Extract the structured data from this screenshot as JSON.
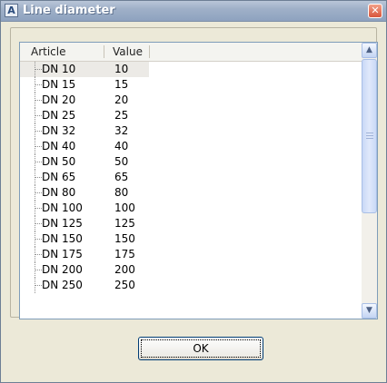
{
  "window": {
    "title": "Line diameter",
    "app_icon_glyph": "A",
    "close_glyph": "✕"
  },
  "list": {
    "columns": {
      "article": "Article",
      "value": "Value"
    },
    "rows": [
      {
        "article": "DN 10",
        "value": "10"
      },
      {
        "article": "DN 15",
        "value": "15"
      },
      {
        "article": "DN 20",
        "value": "20"
      },
      {
        "article": "DN 25",
        "value": "25"
      },
      {
        "article": "DN 32",
        "value": "32"
      },
      {
        "article": "DN 40",
        "value": "40"
      },
      {
        "article": "DN 50",
        "value": "50"
      },
      {
        "article": "DN 65",
        "value": "65"
      },
      {
        "article": "DN 80",
        "value": "80"
      },
      {
        "article": "DN 100",
        "value": "100"
      },
      {
        "article": "DN 125",
        "value": "125"
      },
      {
        "article": "DN 150",
        "value": "150"
      },
      {
        "article": "DN 175",
        "value": "175"
      },
      {
        "article": "DN 200",
        "value": "200"
      },
      {
        "article": "DN 250",
        "value": "250"
      }
    ],
    "selected_index": 0
  },
  "scrollbar": {
    "up_glyph": "▲",
    "down_glyph": "▼"
  },
  "buttons": {
    "ok": "OK"
  }
}
